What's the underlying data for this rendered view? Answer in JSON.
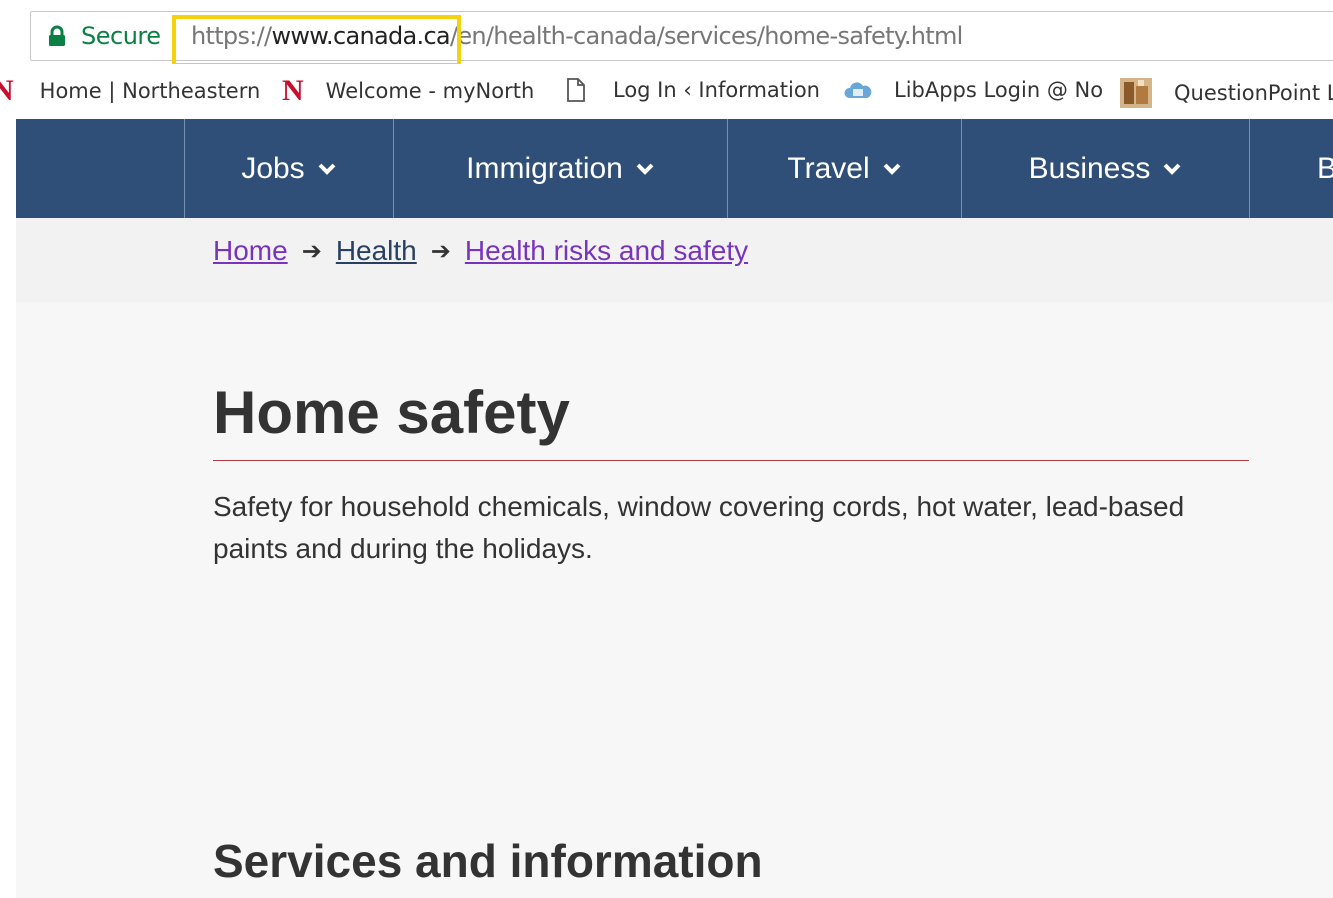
{
  "browser": {
    "secure_label": "Secure",
    "url": {
      "scheme": "https://",
      "host": "www.canada.ca",
      "path": "/en/health-canada/services/home-safety.html"
    },
    "highlight_color": "#f4d20d"
  },
  "bookmarks": [
    {
      "label": "Home | Northeastern",
      "icon": "northeastern-n-icon"
    },
    {
      "label": "Welcome - myNorth",
      "icon": "northeastern-n-icon"
    },
    {
      "label": "Log In ‹ Information",
      "icon": "page-icon"
    },
    {
      "label": "LibApps Login @ No",
      "icon": "cloud-icon"
    },
    {
      "label": "QuestionPoint L",
      "icon": "questionpoint-icon"
    }
  ],
  "nav": {
    "items": [
      {
        "label": "Jobs"
      },
      {
        "label": "Immigration"
      },
      {
        "label": "Travel"
      },
      {
        "label": "Business"
      },
      {
        "label": "B"
      }
    ],
    "background": "#2f4f79"
  },
  "breadcrumb": [
    {
      "label": "Home"
    },
    {
      "label": "Health"
    },
    {
      "label": "Health risks and safety"
    }
  ],
  "page": {
    "title": "Home safety",
    "lede": "Safety for household chemicals, window covering cords, hot water, lead-based paints and during the holidays.",
    "section_heading": "Services and information"
  }
}
